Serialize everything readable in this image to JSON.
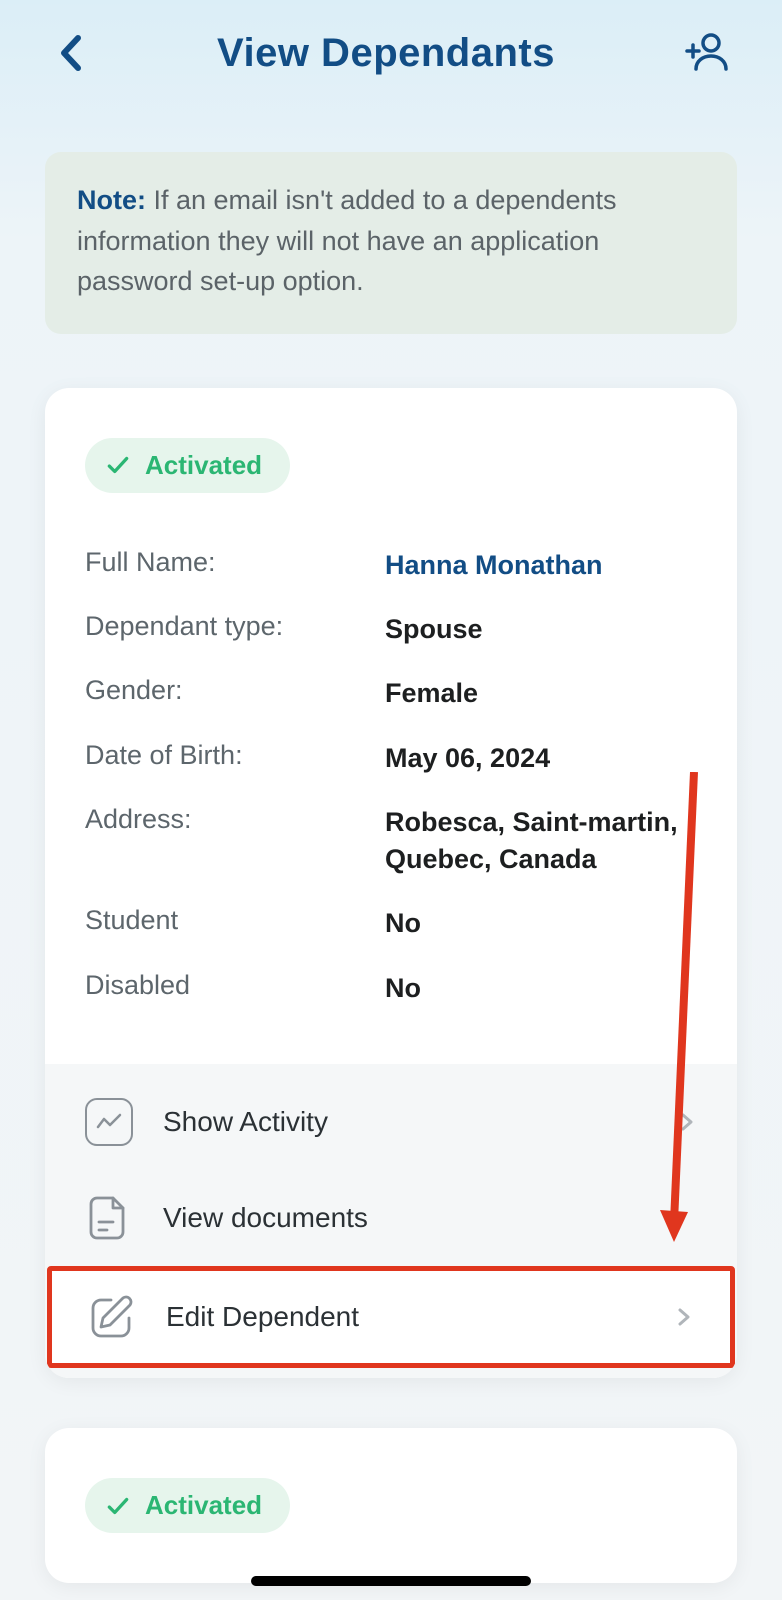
{
  "header": {
    "title": "View Dependants"
  },
  "note": {
    "label": "Note:",
    "text": " If an email isn't added to a dependents information they will not have an application password set-up option."
  },
  "card1": {
    "status": "Activated",
    "fields": {
      "fullName": {
        "label": "Full Name:",
        "value": "Hanna Monathan"
      },
      "type": {
        "label": "Dependant type:",
        "value": "Spouse"
      },
      "gender": {
        "label": "Gender:",
        "value": "Female"
      },
      "dob": {
        "label": "Date of Birth:",
        "value": "May 06, 2024"
      },
      "address": {
        "label": "Address:",
        "value": "Robesca, Saint-martin, Quebec, Canada"
      },
      "student": {
        "label": "Student",
        "value": "No"
      },
      "disabled": {
        "label": "Disabled",
        "value": "No"
      }
    },
    "actions": {
      "activity": "Show Activity",
      "documents": "View documents",
      "edit": "Edit Dependent"
    }
  },
  "card2": {
    "status": "Activated"
  }
}
